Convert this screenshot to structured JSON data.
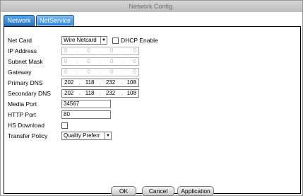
{
  "window": {
    "title": "Network Config."
  },
  "tabs": [
    {
      "label": "Network"
    },
    {
      "label": "NetService"
    }
  ],
  "form": {
    "net_card": {
      "label": "Net Card",
      "value": "Wire Netcard",
      "dhcp_label": "DHCP Enable",
      "dhcp_checked": false
    },
    "ip_address": {
      "label": "IP Address",
      "octets": [
        "0",
        "0",
        "0",
        "0"
      ]
    },
    "subnet_mask": {
      "label": "Subnet Mask",
      "octets": [
        "0",
        "0",
        "0",
        "0"
      ]
    },
    "gateway": {
      "label": "Gateway",
      "octets": [
        "0",
        "0",
        "0",
        "0"
      ]
    },
    "primary_dns": {
      "label": "Primary DNS",
      "octets": [
        "202",
        "118",
        "232",
        "108"
      ]
    },
    "secondary_dns": {
      "label": "Secondary DNS",
      "octets": [
        "202",
        "118",
        "232",
        "108"
      ]
    },
    "media_port": {
      "label": "Media Port",
      "value": "34567"
    },
    "http_port": {
      "label": "HTTP Port",
      "value": "80"
    },
    "hs_download": {
      "label": "HS Download",
      "checked": false
    },
    "transfer_policy": {
      "label": "Transfer Policy",
      "value": "Quality Preferr"
    }
  },
  "buttons": {
    "ok": "OK",
    "cancel": "Cancel",
    "apply": "Application"
  }
}
